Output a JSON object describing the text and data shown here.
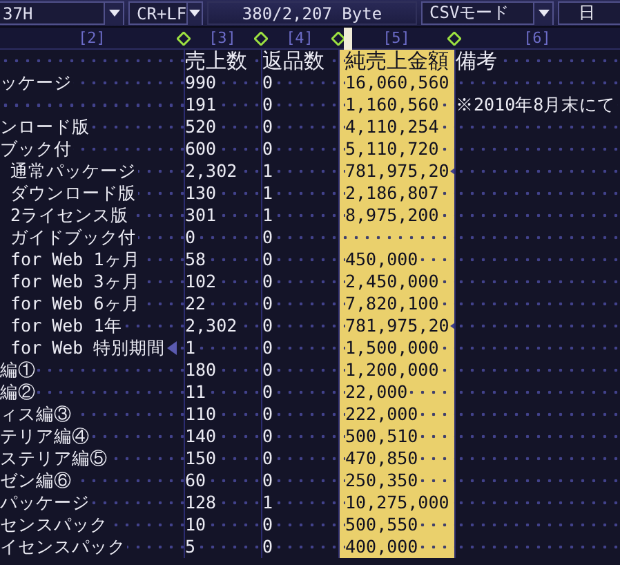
{
  "toolbar": {
    "items": [
      {
        "kind": "dropdown",
        "value": "37H"
      },
      {
        "kind": "dropdown",
        "value": "CR+LF"
      },
      {
        "kind": "label",
        "value": "380/2,207 Byte"
      },
      {
        "kind": "dropdown",
        "value": "CSVモード"
      },
      {
        "kind": "field",
        "value": "日"
      }
    ]
  },
  "ruler": [
    "[2]",
    "[3]",
    "[4]",
    "[5]",
    "[6]"
  ],
  "table": {
    "columns": [
      {
        "label": "売上数",
        "highlighted": false
      },
      {
        "label": "返品数",
        "highlighted": false
      },
      {
        "label": "純売上金額",
        "highlighted": true
      },
      {
        "label": "備考",
        "highlighted": false
      }
    ],
    "rows": [
      {
        "name": "ッケージ",
        "sales": "990",
        "returns": "0",
        "net": "16,060,560",
        "name_cut": false,
        "net_cut": false
      },
      {
        "sales": "191",
        "returns": "0",
        "net": "1,160,560",
        "note": "※2010年8月末にて",
        "name_cut": false,
        "net_cut": false
      },
      {
        "name": "ンロード版",
        "sales": "520",
        "returns": "0",
        "net": "4,110,254",
        "name_cut": false,
        "net_cut": false
      },
      {
        "name": "ブック付",
        "sales": "600",
        "returns": "0",
        "net": "5,110,720",
        "name_cut": false,
        "net_cut": false
      },
      {
        "name": " 通常パッケージ",
        "sales": "2,302",
        "returns": "1",
        "net": "781,975,20",
        "name_cut": false,
        "net_cut": true
      },
      {
        "name": " ダウンロード版",
        "sales": "130",
        "returns": "1",
        "net": "2,186,807",
        "name_cut": false,
        "net_cut": false
      },
      {
        "name": " 2ライセンス版",
        "sales": "301",
        "returns": "1",
        "net": "8,975,200",
        "name_cut": false,
        "net_cut": false
      },
      {
        "name": " ガイドブック付",
        "sales": "0",
        "returns": "0",
        "name_cut": false,
        "net_cut": false
      },
      {
        "name": " for Web 1ヶ月",
        "sales": "58",
        "returns": "0",
        "net": "450,000",
        "name_cut": false,
        "net_cut": false
      },
      {
        "name": " for Web 3ヶ月",
        "sales": "102",
        "returns": "0",
        "net": "2,450,000",
        "name_cut": false,
        "net_cut": false
      },
      {
        "name": " for Web 6ヶ月",
        "sales": "22",
        "returns": "0",
        "net": "7,820,100",
        "name_cut": false,
        "net_cut": false
      },
      {
        "name": " for Web 1年",
        "sales": "2,302",
        "returns": "0",
        "net": "781,975,20",
        "name_cut": false,
        "net_cut": true
      },
      {
        "name": " for Web 特別期間",
        "sales": "1",
        "returns": "0",
        "net": "1,500,000",
        "name_cut": true,
        "net_cut": false
      },
      {
        "name": "編①",
        "sales": "180",
        "returns": "0",
        "net": "1,200,000",
        "name_cut": false,
        "net_cut": false
      },
      {
        "name": "編②",
        "sales": "11",
        "returns": "0",
        "net": "22,000",
        "name_cut": false,
        "net_cut": false
      },
      {
        "name": "ィス編③",
        "sales": "110",
        "returns": "0",
        "net": "222,000",
        "name_cut": false,
        "net_cut": false
      },
      {
        "name": "テリア編④",
        "sales": "140",
        "returns": "0",
        "net": "500,510",
        "name_cut": false,
        "net_cut": false
      },
      {
        "name": "ステリア編⑤",
        "sales": "150",
        "returns": "0",
        "net": "470,850",
        "name_cut": false,
        "net_cut": false
      },
      {
        "name": "ゼン編⑥",
        "sales": "60",
        "returns": "0",
        "net": "250,350",
        "name_cut": false,
        "net_cut": false
      },
      {
        "name": "パッケージ",
        "sales": "128",
        "returns": "1",
        "net": "10,275,000",
        "name_cut": false,
        "net_cut": false
      },
      {
        "name": "センスパック",
        "sales": "10",
        "returns": "0",
        "net": "500,550",
        "name_cut": false,
        "net_cut": false
      },
      {
        "name": "イセンスパック",
        "sales": "5",
        "returns": "0",
        "net": "400,000",
        "name_cut": false,
        "net_cut": false
      }
    ]
  }
}
